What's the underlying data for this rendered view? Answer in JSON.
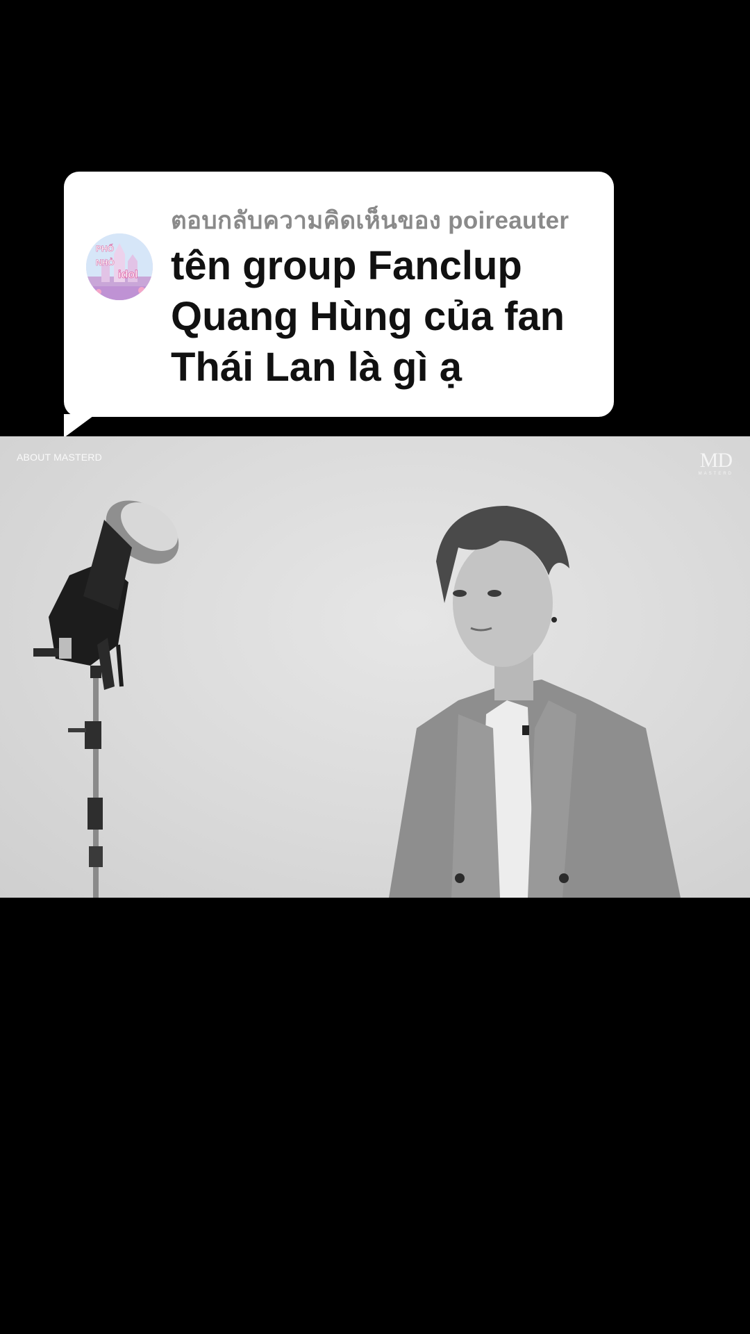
{
  "reply": {
    "header": "ตอบกลับความคิดเห็นของ poireauter",
    "comment": "tên group Fanclup Quang Hùng của fan Thái Lan là gì ạ",
    "avatar_icon": "profile-avatar-castle",
    "avatar_text_lines": [
      "PHỐ",
      "NHỎ",
      "idol"
    ]
  },
  "video": {
    "watermark_left": "ABOUT MASTERD",
    "watermark_right_logo": "MD",
    "watermark_right_sub": "MASTERD"
  }
}
